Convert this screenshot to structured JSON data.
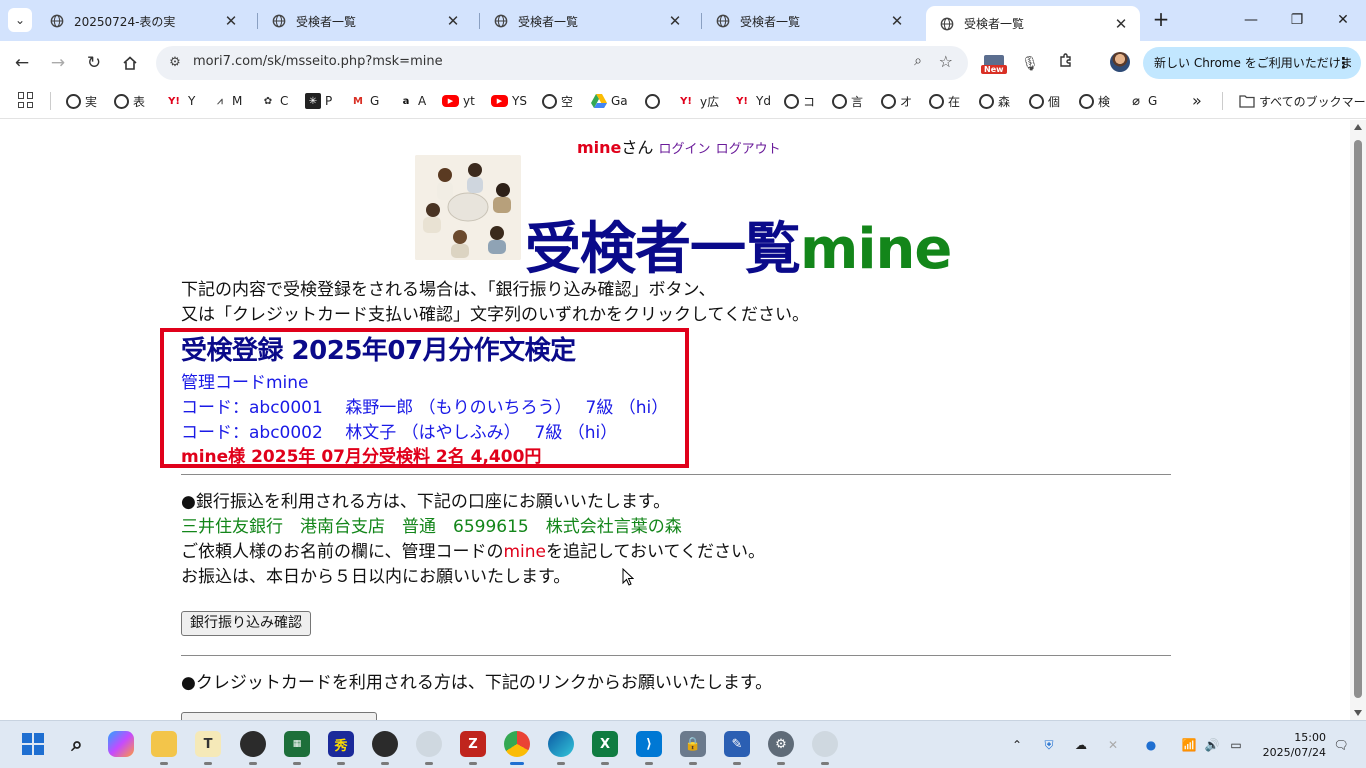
{
  "tabs": [
    {
      "title": "20250724-表の実",
      "active": false
    },
    {
      "title": "受検者一覧",
      "active": false
    },
    {
      "title": "受検者一覧",
      "active": false
    },
    {
      "title": "受検者一覧",
      "active": false
    },
    {
      "title": "受検者一覧",
      "active": true
    }
  ],
  "toolbar": {
    "url": "mori7.com/sk/msseito.php?msk=mine",
    "new_badge": "New",
    "update_label": "新しい Chrome をご利用いただけます",
    "more_label": "⋮"
  },
  "bookmarks": {
    "items": [
      {
        "icon": "globe-icon",
        "label": "実"
      },
      {
        "icon": "globe-icon",
        "label": "表"
      },
      {
        "icon": "yahoo-icon",
        "label": "Y"
      },
      {
        "icon": "chart-icon",
        "label": "M"
      },
      {
        "icon": "chatgpt-icon",
        "label": "C"
      },
      {
        "icon": "perplexity-icon",
        "label": "P"
      },
      {
        "icon": "gmail-icon",
        "label": "G"
      },
      {
        "icon": "amazon-icon",
        "label": "A"
      },
      {
        "icon": "youtube-icon",
        "label": "yt"
      },
      {
        "icon": "youtube-icon",
        "label": "YS"
      },
      {
        "icon": "globe-icon",
        "label": "空"
      },
      {
        "icon": "google-drive-icon",
        "label": "Ga"
      },
      {
        "icon": "globe-icon",
        "label": ""
      },
      {
        "icon": "yahoo-icon",
        "label": "y広"
      },
      {
        "icon": "yahoo-icon",
        "label": "Yd"
      },
      {
        "icon": "globe-icon",
        "label": "コ"
      },
      {
        "icon": "globe-icon",
        "label": "言"
      },
      {
        "icon": "globe-icon",
        "label": "オ"
      },
      {
        "icon": "globe-icon",
        "label": "在"
      },
      {
        "icon": "globe-icon",
        "label": "森"
      },
      {
        "icon": "globe-icon",
        "label": "個"
      },
      {
        "icon": "globe-icon",
        "label": "検"
      },
      {
        "icon": "globe-off-icon",
        "label": "G"
      }
    ],
    "overflow": "»",
    "all_bookmarks": "すべてのブックマーク"
  },
  "page": {
    "user_name": "mine",
    "user_suffix": "さん",
    "login_link": "ログイン",
    "logout_link": "ログアウト",
    "title_main": "受検者一覧",
    "title_suffix": "mine",
    "intro_line1": "下記の内容で受検登録をされる場合は、「銀行振り込み確認」ボタン、",
    "intro_line2": "又は「クレジットカード支払い確認」文字列のいずれかをクリックしてください。",
    "registration": {
      "title": "受検登録 2025年07月分作文検定",
      "admin_code": "管理コードmine",
      "examinees": [
        "コード：abc0001　 森野一郎 （もりのいちろう）　 7級 （hi）",
        "コード：abc0002　 林文子 （はやしふみ）　 7級 （hi）"
      ],
      "fee": "mine様 2025年 07月分受検料 2名 4,400円"
    },
    "bank": {
      "heading": "●銀行振込を利用される方は、下記の口座にお願いいたします。",
      "account": "三井住友銀行　港南台支店　普通　6599615　株式会社言葉の森",
      "note_prefix": "ご依頼人様のお名前の欄に、管理コードの",
      "note_code": "mine",
      "note_suffix": "を追記しておいてください。",
      "deadline": "お振込は、本日から５日以内にお願いいたします。",
      "button_label": "銀行振り込み確認"
    },
    "card": {
      "heading": "●クレジットカードを利用される方は、下記のリンクからお願いいたします。"
    }
  },
  "taskbar": {
    "time": "15:00",
    "date": "2025/07/24"
  },
  "colors": {
    "title_blue": "#0a0a8a",
    "title_green": "#13861a",
    "alert_red": "#e0001a",
    "link_blue": "#1a1ae6",
    "tab_strip": "#d3e3fd"
  }
}
